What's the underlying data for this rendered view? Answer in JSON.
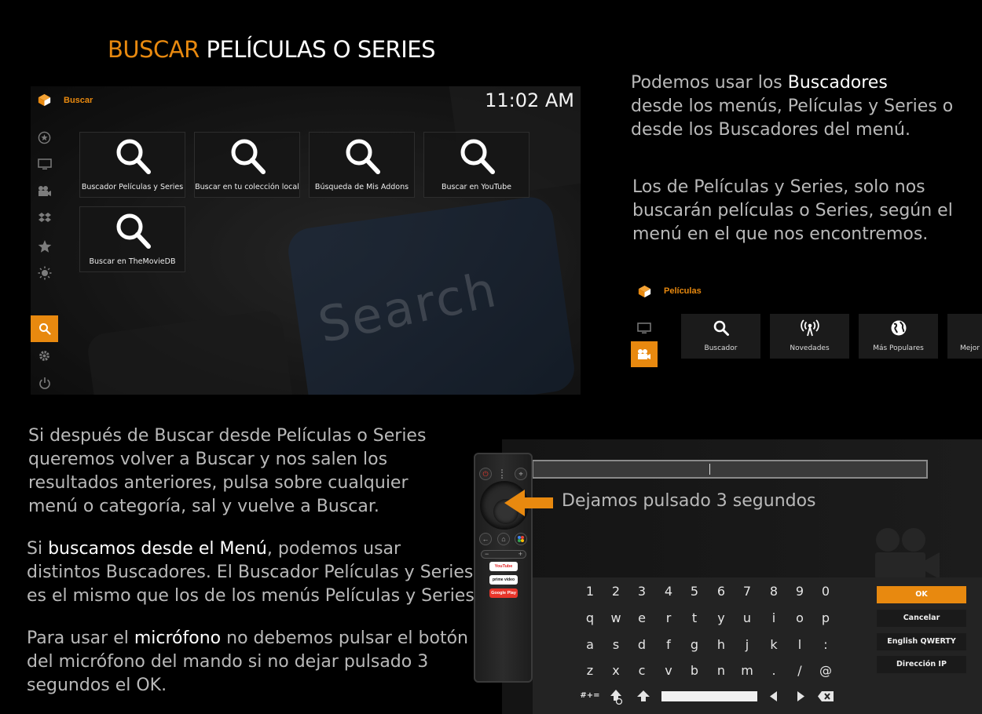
{
  "title": {
    "accent": "BUSCAR",
    "rest": "PELÍCULAS O SERIES"
  },
  "colors": {
    "accent": "#e8890f",
    "text_muted": "#b9b9b9",
    "background": "#000000"
  },
  "main_screen": {
    "app_name": "Buscar",
    "clock": "11:02 AM",
    "background_word": "Search",
    "sidebar_icons": [
      "star-circle-icon",
      "tv-icon",
      "movie-camera-icon",
      "dropbox-icon",
      "star-icon",
      "sun-icon",
      "search-icon",
      "gear-icon",
      "power-icon"
    ],
    "tiles": [
      {
        "label": "Buscador Películas y Series",
        "icon": "search-icon"
      },
      {
        "label": "Buscar en tu colección local",
        "icon": "search-icon"
      },
      {
        "label": "Búsqueda de Mis Addons",
        "icon": "search-icon"
      },
      {
        "label": "Buscar en YouTube",
        "icon": "search-icon"
      },
      {
        "label": "Buscar en TheMovieDB",
        "icon": "search-icon"
      }
    ]
  },
  "right_text": {
    "p1_a": "Podemos usar los ",
    "p1_hl": "Buscadores",
    "p1_b": "desde los menús, Películas y Series o",
    "p1_c": "desde los Buscadores del menú.",
    "p2_a": "Los de Películas y Series, solo nos",
    "p2_b": "buscarán películas o Series, según el",
    "p2_c": "menú en el que nos encontremos."
  },
  "menu_shot": {
    "app_name": "Películas",
    "tiles": [
      {
        "label": "Buscador",
        "icon": "search-icon"
      },
      {
        "label": "Novedades",
        "icon": "broadcast-icon"
      },
      {
        "label": "Más Populares",
        "icon": "globe-icon"
      },
      {
        "label": "Mejor V",
        "icon": "star-icon"
      }
    ]
  },
  "left_text": {
    "p1_a": "Si después de Buscar desde Películas o Series",
    "p1_b": "queremos volver a Buscar y nos salen los",
    "p1_c": "resultados anteriores, pulsa sobre cualquier",
    "p1_d": "menú o categoría, sal y vuelve a Buscar.",
    "p2_pre": "Si ",
    "p2_hl": "buscamos desde el Menú",
    "p2_post": ", podemos usar",
    "p2_b": "distintos Buscadores. El Buscador Películas y Series",
    "p2_c": "es el mismo que los de los menús Películas y Series.",
    "p3_pre": "Para usar el ",
    "p3_hl": "micrófono",
    "p3_post": " no debemos pulsar el botón",
    "p3_b": "del micrófono del mando si no dejar pulsado 3",
    "p3_c": "segundos el OK."
  },
  "arrow_label": "Dejamos pulsado 3 segundos",
  "remote": {
    "logos": [
      {
        "label": "YouTube",
        "color": "#ff0000",
        "text": "#fff"
      },
      {
        "label": "prime video",
        "color": "#ffffff",
        "text": "#111"
      },
      {
        "label": "Google Play",
        "color": "#e8352a",
        "text": "#fff"
      }
    ]
  },
  "keyboard": {
    "rows": [
      [
        "1",
        "2",
        "3",
        "4",
        "5",
        "6",
        "7",
        "8",
        "9",
        "0"
      ],
      [
        "q",
        "w",
        "e",
        "r",
        "t",
        "y",
        "u",
        "i",
        "o",
        "p"
      ],
      [
        "a",
        "s",
        "d",
        "f",
        "g",
        "h",
        "j",
        "k",
        "l",
        ":"
      ],
      [
        "z",
        "x",
        "c",
        "v",
        "b",
        "n",
        "m",
        ".",
        "/",
        "@"
      ]
    ],
    "symbols_key": "#+=",
    "buttons": [
      "OK",
      "Cancelar",
      "English QWERTY",
      "Dirección IP"
    ]
  }
}
